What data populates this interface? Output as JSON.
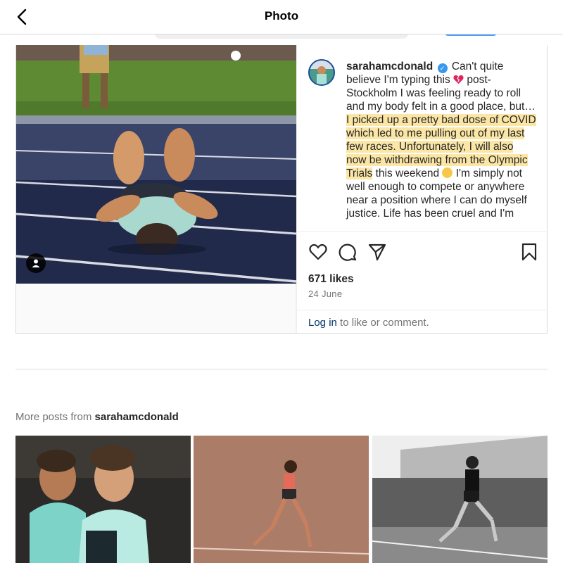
{
  "nav": {
    "title": "Photo",
    "back_icon": "chevron-left-icon"
  },
  "post": {
    "username": "sarahamcdonald",
    "verified_icon": "verified-badge-icon",
    "caption": {
      "part1": "Can't quite believe I'm typing this",
      "part2": "post-Stockholm I was feeling ready to roll and my body felt in a good place, but…",
      "highlighted": "I picked up a pretty bad dose of COVID which led to me pulling out of my last few races. Unfortunately, I will also now be withdrawing from the Olympic Trials",
      "part3": "this weekend",
      "part4": "I'm simply not well enough to compete or anywhere near a position where I can do myself justice. Life has been cruel and I'm"
    },
    "likes": "671 likes",
    "date": "24 June",
    "login": {
      "link": "Log in",
      "rest": "to like or comment."
    },
    "actions": [
      "heart-icon",
      "comment-icon",
      "share-icon",
      "bookmark-icon"
    ],
    "tag_icon": "person-tag-icon"
  },
  "more": {
    "prefix": "More posts from",
    "username": "sarahamcdonald"
  },
  "colors": {
    "highlight": "#fbe6a6",
    "link": "#00376b",
    "verified": "#3897f0",
    "track": "#1d2540"
  }
}
